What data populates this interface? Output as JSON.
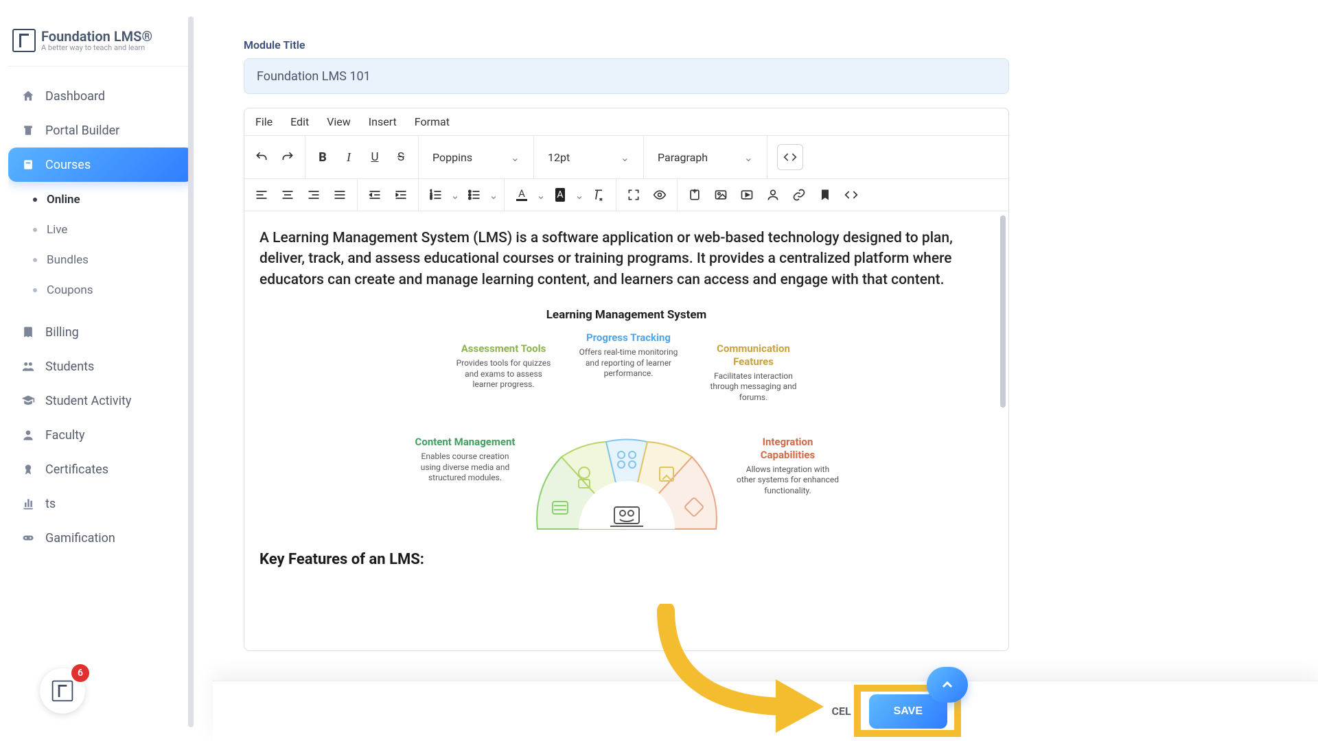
{
  "brand": {
    "title": "Foundation LMS®",
    "tagline": "A better way to teach and learn"
  },
  "notifications": {
    "count": "6"
  },
  "sidebar": {
    "items": [
      {
        "label": "Dashboard"
      },
      {
        "label": "Portal Builder"
      },
      {
        "label": "Courses"
      },
      {
        "label": "Billing"
      },
      {
        "label": "Students"
      },
      {
        "label": "Student Activity"
      },
      {
        "label": "Faculty"
      },
      {
        "label": "Certificates"
      },
      {
        "label": "ts"
      },
      {
        "label": "Gamification"
      }
    ],
    "courses_sub": [
      {
        "label": "Online"
      },
      {
        "label": "Live"
      },
      {
        "label": "Bundles"
      },
      {
        "label": "Coupons"
      }
    ]
  },
  "module": {
    "title_label": "Module Title",
    "title_value": "Foundation LMS 101"
  },
  "editor": {
    "menu": [
      "File",
      "Edit",
      "View",
      "Insert",
      "Format"
    ],
    "font_family": "Poppins",
    "font_size": "12pt",
    "block_format": "Paragraph",
    "body_para": "A Learning Management System (LMS) is a software application or web-based technology designed to plan, deliver, track, and assess educational courses or training programs. It provides a centralized platform where educators can create and manage learning content, and learners can access and engage with that content.",
    "diagram_title": "Learning Management System",
    "heading2": "Key Features of an LMS:"
  },
  "infographic": {
    "progress": {
      "title": "Progress Tracking",
      "desc": "Offers real-time monitoring and reporting of learner performance.",
      "color": "#4fa6e8"
    },
    "assessment": {
      "title": "Assessment Tools",
      "desc": "Provides tools for quizzes and exams to assess learner progress.",
      "color": "#8cb34c"
    },
    "communication": {
      "title": "Communication Features",
      "desc": "Facilitates interaction through messaging and forums.",
      "color": "#c9a23e"
    },
    "content": {
      "title": "Content Management",
      "desc": "Enables course creation using diverse media and structured modules.",
      "color": "#3fa060"
    },
    "integration": {
      "title": "Integration Capabilities",
      "desc": "Allows integration with other systems for enhanced functionality.",
      "color": "#d06a48"
    }
  },
  "footer": {
    "cancel_fragment": "CEL",
    "save": "SAVE"
  }
}
